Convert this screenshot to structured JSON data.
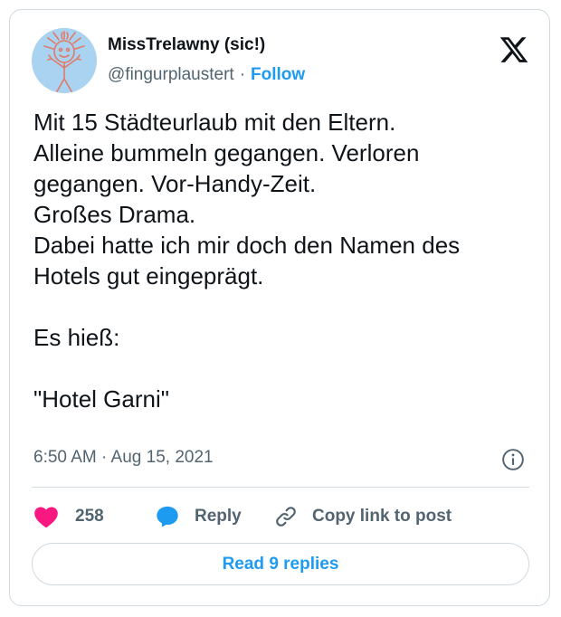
{
  "user": {
    "display_name": "MissTrelawny (sic!)",
    "handle": "@fingurplaustert",
    "separator": "·",
    "follow_label": "Follow"
  },
  "logo": {
    "icon": "x-logo-icon"
  },
  "tweet": {
    "lines": [
      "Mit 15 Städteurlaub mit den Eltern.",
      "Alleine bummeln gegangen. Verloren",
      "gegangen. Vor-Handy-Zeit.",
      "Großes Drama.",
      "Dabei hatte ich mir doch den Namen des",
      "Hotels gut eingeprägt.",
      "",
      "Es hieß:",
      "",
      "\"Hotel Garni\""
    ],
    "timestamp": "6:50 AM · Aug 15, 2021"
  },
  "actions": {
    "like_count": "258",
    "reply_label": "Reply",
    "copy_link_label": "Copy link to post"
  },
  "footer": {
    "read_replies_label": "Read 9 replies"
  },
  "colors": {
    "accent": "#1d9bf0",
    "like": "#f91880",
    "text": "#0f1419",
    "secondary_text": "#536471",
    "border": "#cfd9de"
  }
}
